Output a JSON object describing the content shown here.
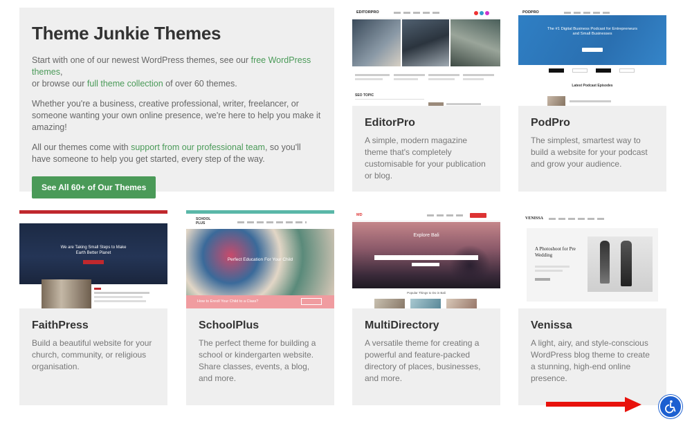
{
  "intro": {
    "title": "Theme Junkie Themes",
    "p1_a": "Start with one of our newest WordPress themes, see our ",
    "p1_link1": "free WordPress themes",
    "p1_b": ",",
    "p1_c": "or browse our ",
    "p1_link2": "full theme collection",
    "p1_d": " of over 60 themes.",
    "p2": "Whether you're a business, creative professional, writer, freelancer, or someone wanting your own online presence, we're here to help you make it amazing!",
    "p3_a": "All our themes come with ",
    "p3_link": "support from our professional team",
    "p3_b": ", so you'll have someone to help you get started, every step of the way.",
    "button": "See All 60+ of Our Themes"
  },
  "themes": [
    {
      "name": "EditorPro",
      "desc": "A simple, modern magazine theme that's completely customisable for your publication or blog."
    },
    {
      "name": "PodPro",
      "desc": "The simplest, smartest way to build a website for your podcast and grow your audience."
    },
    {
      "name": "FaithPress",
      "desc": "Build a beautiful website for your church, community, or religious organisation."
    },
    {
      "name": "SchoolPlus",
      "desc": "The perfect theme for building a school or kindergarten website. Share classes, events, a blog, and more."
    },
    {
      "name": "MultiDirectory",
      "desc": "A versatile theme for creating a powerful and feature-packed directory of places, businesses, and more."
    },
    {
      "name": "Venissa",
      "desc": "A light, airy, and style-conscious WordPress blog theme to create a stunning, high-end online presence."
    }
  ],
  "thumbs": {
    "editorpro": {
      "logo": "EDITORPRO",
      "section": "SEO TOPIC"
    },
    "podpro": {
      "logo": "PODPRO",
      "hero": "The #1 Digital Business Podcast for Entrepreneurs and Small Businesses",
      "latest": "Latest Podcast Episodes",
      "platforms": [
        "Podcasts",
        "Spotify",
        "Google Play",
        "YouTube"
      ]
    },
    "faithpress": {
      "hero": "We are Taking Small Steps to Make Earth Better Planet"
    },
    "schoolplus": {
      "logo": "SCHOOL PLUS",
      "hero": "Perfect Education For Your Child",
      "bar": "How to Enroll Your Child to a Class?"
    },
    "multidirectory": {
      "hero": "Explore Bali",
      "section": "Popular Things to Do in Bali"
    },
    "venissa": {
      "logo": "VENISSA",
      "hero": "A Photoshoot for Pre Wedding"
    }
  },
  "accessibility": {
    "icon": "accessibility-icon"
  },
  "colors": {
    "accent": "#4a9a58",
    "arrow": "#e8120c",
    "a11y": "#1c5fd0"
  }
}
